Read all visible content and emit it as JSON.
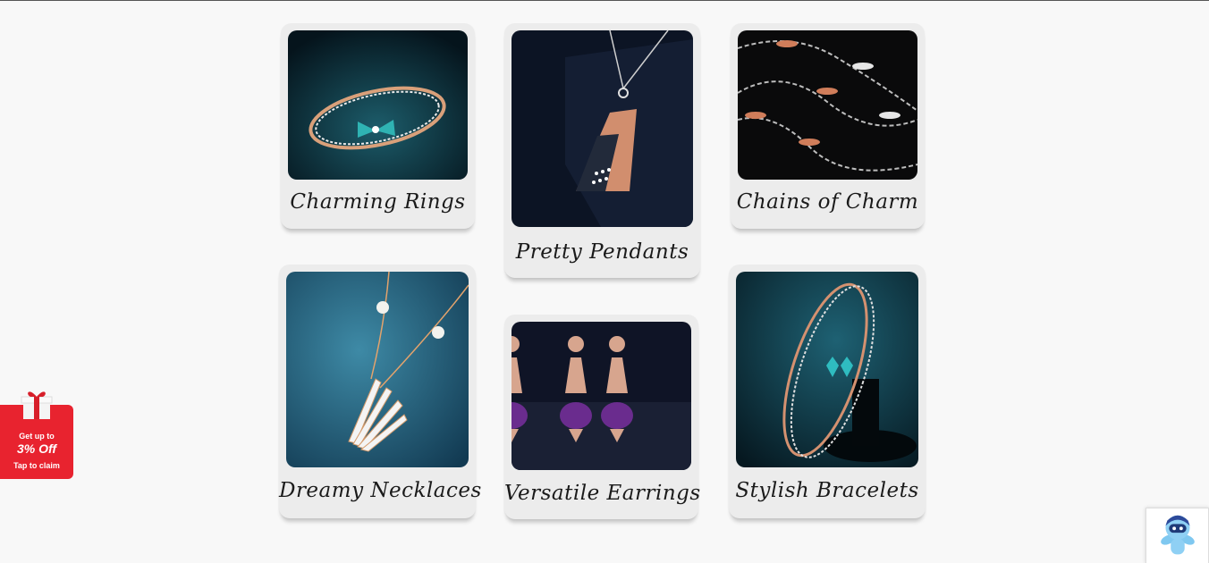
{
  "categories": [
    {
      "label": "Charming Rings"
    },
    {
      "label": "Pretty Pendants"
    },
    {
      "label": "Chains of Charm"
    },
    {
      "label": "Dreamy Necklaces"
    },
    {
      "label": "Versatile Earrings"
    },
    {
      "label": "Stylish Bracelets"
    }
  ],
  "offer": {
    "line1": "Get up to",
    "line2": "3% Off",
    "line3": "Tap to claim",
    "icon": "gift-box-icon",
    "color": "#e8232f"
  },
  "chat_widget": {
    "icon": "assistant-bot-icon"
  }
}
